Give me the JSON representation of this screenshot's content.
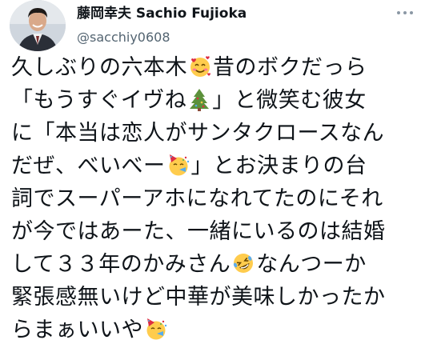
{
  "user": {
    "display_name": "藤岡幸夫 Sachio Fujioka",
    "handle": "@sacchiy0608"
  },
  "tweet": {
    "lines": [
      {
        "a": "久しぶりの六本木",
        "emoji": "smiling-face-with-hearts-icon",
        "b": "昔のボクだっら"
      },
      {
        "a": "「もうすぐイヴね",
        "emoji": "christmas-tree-icon",
        "b": "」と微笑む彼女"
      },
      {
        "a": "に「本当は恋人がサンタクロースなん",
        "emoji": "",
        "b": ""
      },
      {
        "a": "だぜ、べいべー",
        "emoji": "partying-face-icon",
        "b": "」とお決まりの台"
      },
      {
        "a": "詞でスーパーアホになれてたのにそれ",
        "emoji": "",
        "b": ""
      },
      {
        "a": "が今ではあーた、一緒にいるのは結婚",
        "emoji": "",
        "b": ""
      },
      {
        "a": "して３３年のかみさん",
        "emoji": "rolling-on-floor-laughing-icon",
        "b": "なんつーか"
      },
      {
        "a": "緊張感無いけど中華が美味しかったか",
        "emoji": "",
        "b": ""
      },
      {
        "a": "らまぁいいや",
        "emoji": "partying-face-icon",
        "b": ""
      }
    ]
  },
  "icons": {
    "more": "more-horizontal-icon"
  }
}
